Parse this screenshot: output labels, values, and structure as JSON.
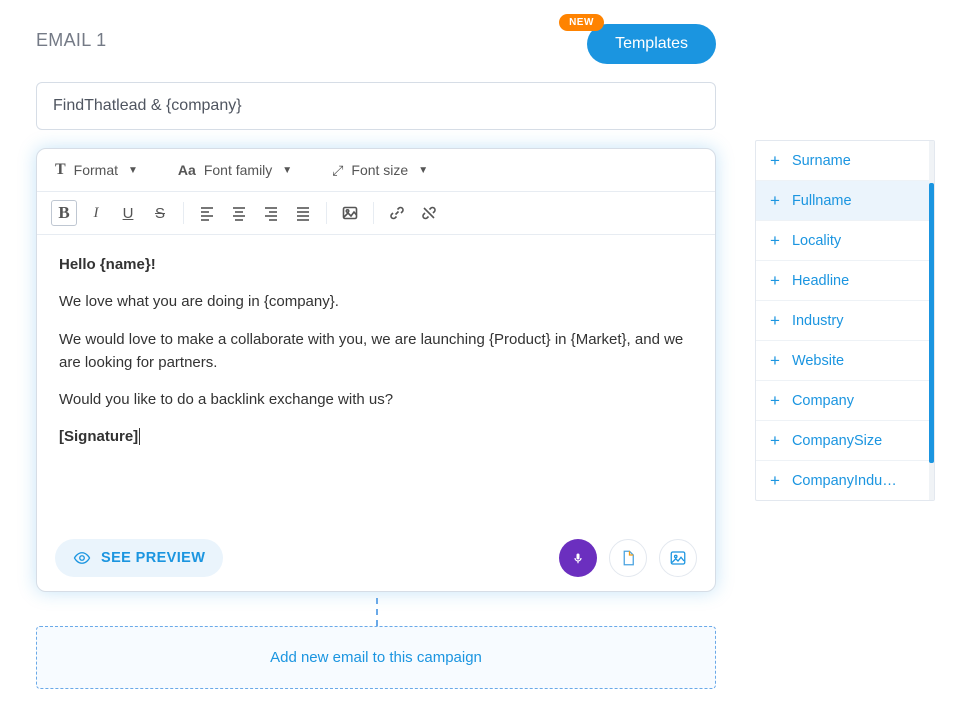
{
  "header": {
    "title": "EMAIL 1",
    "new_badge": "NEW",
    "templates_label": "Templates"
  },
  "subject": {
    "value": "FindThatlead & {company}"
  },
  "toolbar": {
    "format_label": "Format",
    "font_family_label": "Font family",
    "font_size_label": "Font size"
  },
  "body": {
    "greeting": "Hello {name}!",
    "line1": "We love what you are doing in {company}.",
    "line2": "We would love to make a collaborate with you, we are launching {Product} in {Market}, and we are looking for partners.",
    "line3": "Would you like to do a backlink exchange with us?",
    "signature": "[Signature]"
  },
  "footer": {
    "preview_label": "SEE PREVIEW"
  },
  "add_email_label": "Add new email to this campaign",
  "fields": [
    {
      "label": "Surname",
      "active": false
    },
    {
      "label": "Fullname",
      "active": true
    },
    {
      "label": "Locality",
      "active": false
    },
    {
      "label": "Headline",
      "active": false
    },
    {
      "label": "Industry",
      "active": false
    },
    {
      "label": "Website",
      "active": false
    },
    {
      "label": "Company",
      "active": false
    },
    {
      "label": "CompanySize",
      "active": false
    },
    {
      "label": "CompanyIndu…",
      "active": false
    }
  ]
}
